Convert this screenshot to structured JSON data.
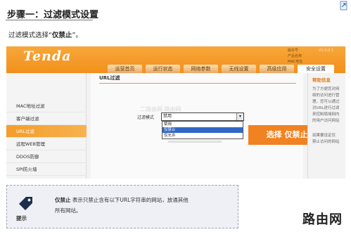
{
  "step_title": "步骤一：过滤模式设置",
  "intro": {
    "prefix": "过滤模式选择“",
    "highlight": "仅禁止",
    "suffix": "”。"
  },
  "router": {
    "logo": "Tenda",
    "info_labels": [
      "版本号",
      "产品名称",
      "MAC地址"
    ],
    "info_values": [
      "V1.0.0.1",
      "",
      ""
    ],
    "nav_tabs": [
      "运营首页",
      "运行状态",
      "网络参数",
      "无线设置",
      "高级应用",
      "安全设置"
    ],
    "active_tab_index": 5,
    "sidebar": [
      "MAC地址过滤",
      "客户端过滤",
      "URL过滤",
      "远程WEB管理",
      "DDOS防御",
      "SPI防火墙"
    ],
    "active_sidebar_index": 2,
    "content_title": "URL过滤",
    "filter_label": "过滤模式",
    "select_value": "禁用",
    "select_options": [
      "禁用",
      "仅禁止",
      "仅允许"
    ],
    "selected_option_index": 1,
    "faint_text": "二路由网 路由网",
    "callout": "选择 仅禁止",
    "help_title": "帮助信息",
    "help_lines": [
      "为了方便您对网",
      "络的访问进行管",
      "理，您可以通过",
      "对URL进行过滤",
      "来控制局域网内",
      "的用户访问网站",
      "",
      "如果要设定仅",
      "禁止访问的网站"
    ]
  },
  "tip": {
    "label": "提示",
    "bold": "仅禁止",
    "text_line1": "表示只禁止含有以下URL字符串的网站，放通其他",
    "text_line2": "所有网站。"
  },
  "watermark": "路由网",
  "colors": {
    "orange": "#f2901c",
    "callout": "#f08222",
    "select_blue": "#3168c5"
  }
}
